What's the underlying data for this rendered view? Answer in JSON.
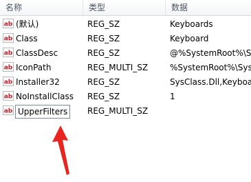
{
  "columns": {
    "name": "名称",
    "type": "类型",
    "data": "数据"
  },
  "rows": [
    {
      "name": "(默认)",
      "type": "REG_SZ",
      "data": "Keyboards"
    },
    {
      "name": "Class",
      "type": "REG_SZ",
      "data": "Keyboard"
    },
    {
      "name": "ClassDesc",
      "type": "REG_SZ",
      "data": "@%SystemRoot%\\Sys"
    },
    {
      "name": "IconPath",
      "type": "REG_MULTI_SZ",
      "data": "%SystemRoot%\\Sys"
    },
    {
      "name": "Installer32",
      "type": "REG_SZ",
      "data": "SysClass.Dll,Keyboa"
    },
    {
      "name": "NoInstallClass",
      "type": "REG_SZ",
      "data": "1"
    },
    {
      "name": "UpperFilters",
      "type": "REG_MULTI_SZ",
      "data": ""
    }
  ],
  "icon": {
    "name": "reg-string-icon",
    "text": "ab",
    "color": "#c4202a"
  },
  "annotation": {
    "name": "red-arrow",
    "color": "#e8261f"
  }
}
